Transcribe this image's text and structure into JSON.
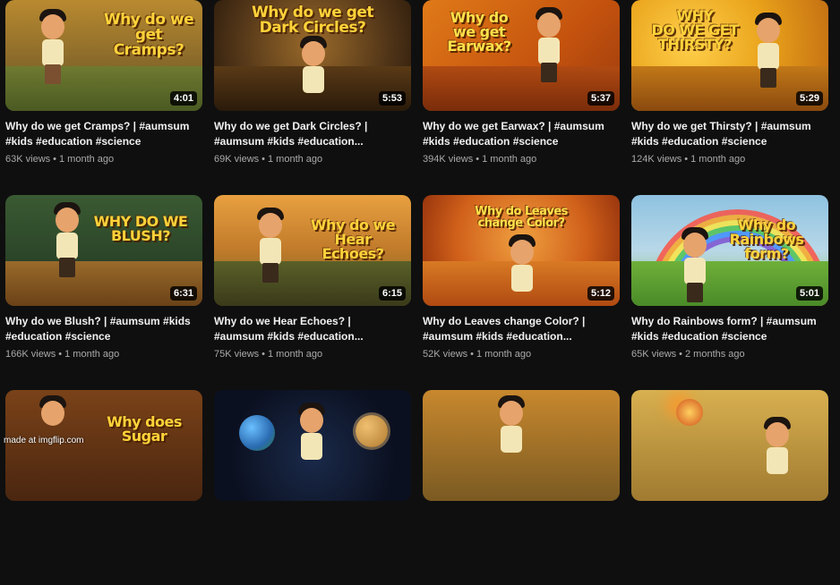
{
  "videos": [
    {
      "title_line1": "Why do we get Cramps? | #aumsum",
      "title_line2": "#kids #education #science",
      "views": "63K views",
      "age": "1 month ago",
      "duration": "4:01",
      "thumb_text": "Why do we\nget\nCramps?",
      "colors": {
        "sky": "#c0902a",
        "ground": "#5a6b2a",
        "text": "#ffd23a"
      }
    },
    {
      "title_line1": "Why do we get Dark Circles? |",
      "title_line2": "#aumsum #kids #education...",
      "views": "69K views",
      "age": "1 month ago",
      "duration": "5:53",
      "thumb_text": "Why do we get\nDark Circles?",
      "colors": {
        "sky": "#6a4620",
        "ground": "#3b2612",
        "text": "#ffd23a"
      }
    },
    {
      "title_line1": "Why do we get Earwax? | #aumsum",
      "title_line2": "#kids #education #science",
      "views": "394K views",
      "age": "1 month ago",
      "duration": "5:37",
      "thumb_text": "Why do\nwe get\nEarwax?",
      "colors": {
        "sky": "#d26a10",
        "ground": "#9a3c0e",
        "text": "#ffe14a"
      }
    },
    {
      "title_line1": "Why do we get Thirsty? | #aumsum",
      "title_line2": "#kids #education #science",
      "views": "124K views",
      "age": "1 month ago",
      "duration": "5:29",
      "thumb_text": "WHY\nDO WE GET\nTHIRSTY?",
      "colors": {
        "sky": "#e9a21a",
        "ground": "#c06a12",
        "text": "#ffd23a"
      }
    },
    {
      "title_line1": "Why do we Blush? | #aumsum #kids",
      "title_line2": "#education #science",
      "views": "166K views",
      "age": "1 month ago",
      "duration": "6:31",
      "thumb_text": "WHY DO WE\nBLUSH?",
      "colors": {
        "sky": "#2f4a2a",
        "ground": "#8a5a2a",
        "text": "#ffd23a"
      }
    },
    {
      "title_line1": "Why do we Hear Echoes? |",
      "title_line2": "#aumsum #kids #education...",
      "views": "75K views",
      "age": "1 month ago",
      "duration": "6:15",
      "thumb_text": "Why do we\nHear\nEchoes?",
      "colors": {
        "sky": "#d08a2a",
        "ground": "#5a5a2a",
        "text": "#ffd23a"
      }
    },
    {
      "title_line1": "Why do Leaves change Color? |",
      "title_line2": "#aumsum #kids #education...",
      "views": "52K views",
      "age": "1 month ago",
      "duration": "5:12",
      "thumb_text": "Why do Leaves\nchange Color?",
      "colors": {
        "sky": "#c2501a",
        "ground": "#d06a1a",
        "text": "#ffe14a"
      }
    },
    {
      "title_line1": "Why do Rainbows form? | #aumsum",
      "title_line2": "#kids #education #science",
      "views": "65K views",
      "age": "2 months ago",
      "duration": "5:01",
      "thumb_text": "Why do\nRainbows\nform?",
      "colors": {
        "sky": "#7fb6d6",
        "ground": "#6aa53a",
        "text": "#ffd23a"
      }
    },
    {
      "title_line1": "",
      "title_line2": "",
      "views": "",
      "age": "",
      "duration": "",
      "thumb_text": "Why does\nSugar",
      "colors": {
        "sky": "#6a3a1a",
        "ground": "#3a2010",
        "text": "#ffd23a"
      }
    },
    {
      "title_line1": "",
      "title_line2": "",
      "views": "",
      "age": "",
      "duration": "",
      "thumb_text": "",
      "colors": {
        "sky": "#0b1020",
        "ground": "#0b1020",
        "text": "#ffd23a"
      }
    },
    {
      "title_line1": "",
      "title_line2": "",
      "views": "",
      "age": "",
      "duration": "",
      "thumb_text": "",
      "colors": {
        "sky": "#b8732a",
        "ground": "#4a3a1a",
        "text": "#ffd23a"
      }
    },
    {
      "title_line1": "",
      "title_line2": "",
      "views": "",
      "age": "",
      "duration": "",
      "thumb_text": "",
      "colors": {
        "sky": "#c8a040",
        "ground": "#4a5a2a",
        "text": "#ffd23a"
      }
    }
  ],
  "watermark": "made at imgflip.com"
}
